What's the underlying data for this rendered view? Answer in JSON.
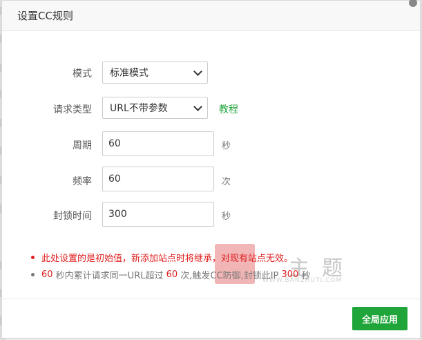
{
  "dialog": {
    "title": "设置CC规则"
  },
  "form": {
    "mode": {
      "label": "模式",
      "value": "标准模式"
    },
    "request_type": {
      "label": "请求类型",
      "value": "URL不带参数",
      "link": "教程"
    },
    "period": {
      "label": "周期",
      "value": "60",
      "unit": "秒"
    },
    "frequency": {
      "label": "频率",
      "value": "60",
      "unit": "次"
    },
    "block_time": {
      "label": "封锁时间",
      "value": "300",
      "unit": "秒"
    }
  },
  "notes": {
    "line1": "此处设置的是初始值，新添加站点时将继承，对现有站点无效。",
    "line2": {
      "period": "60",
      "t1": " 秒内累计请求同一URL超过 ",
      "frequency": "60",
      "t2": " 次,触发CC防御,封锁此IP ",
      "block": "300",
      "t3": " 秒"
    }
  },
  "watermark": {
    "text": "主题",
    "url": "WWW.BANZHUTI.COM"
  },
  "footer": {
    "apply_label": "全局应用"
  },
  "colors": {
    "accent": "#20a53a",
    "warning": "#e02020"
  }
}
